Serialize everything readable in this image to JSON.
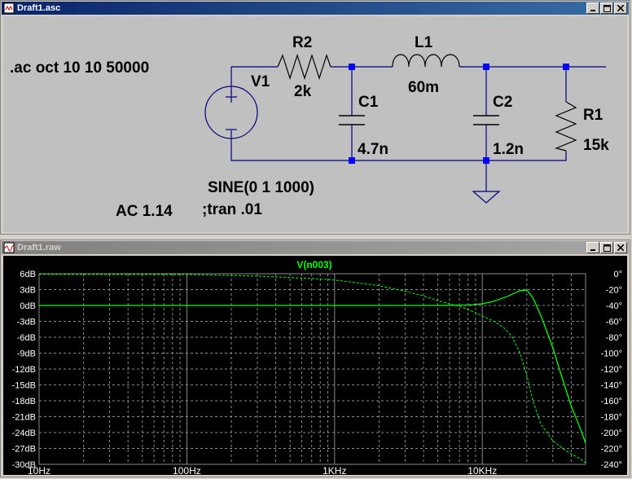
{
  "schematic_window": {
    "title": "Draft1.asc",
    "directives": {
      "ac": ".ac oct 10 10 50000",
      "source_sine": "SINE(0 1 1000)",
      "source_ac": "AC 1.14",
      "tran": ";tran .01"
    },
    "components": {
      "v1_name": "V1",
      "r2_name": "R2",
      "r2_value": "2k",
      "l1_name": "L1",
      "l1_value": "60m",
      "c1_name": "C1",
      "c1_value": "4.7n",
      "c2_name": "C2",
      "c2_value": "1.2n",
      "r1_name": "R1",
      "r1_value": "15k"
    }
  },
  "waveform_window": {
    "title": "Draft1.raw",
    "trace_label": "V(n003)",
    "trace_color": "#00ff00",
    "grid_color": "#8a8a8a"
  },
  "chart_data": {
    "type": "line",
    "x_scale": "log",
    "xlim": [
      10,
      50000
    ],
    "x_ticks": [
      "10Hz",
      "100Hz",
      "1KHz",
      "10KHz"
    ],
    "y_left_ticks": [
      "6dB",
      "3dB",
      "0dB",
      "-3dB",
      "-6dB",
      "-9dB",
      "-12dB",
      "-15dB",
      "-18dB",
      "-21dB",
      "-24dB",
      "-27dB",
      "-30dB"
    ],
    "y_right_ticks": [
      "0°",
      "-20°",
      "-40°",
      "-60°",
      "-80°",
      "-100°",
      "-120°",
      "-140°",
      "-160°",
      "-180°",
      "-200°",
      "-220°",
      "-240°"
    ],
    "ylim_db": [
      -30,
      6
    ],
    "ylim_phase": [
      -240,
      0
    ],
    "series": [
      {
        "name": "V(n003)",
        "axis": "magnitude",
        "x": [
          10,
          100,
          1000,
          5000,
          8000,
          10000,
          12000,
          15000,
          18000,
          20000,
          22000,
          25000,
          30000,
          35000,
          40000,
          45000,
          50000
        ],
        "y": [
          0,
          0,
          0,
          0,
          0.1,
          0.3,
          0.8,
          1.8,
          2.8,
          2.9,
          1.5,
          -2,
          -8,
          -14,
          -19,
          -22.5,
          -26
        ]
      },
      {
        "name": "V(n003)",
        "axis": "phase",
        "x": [
          10,
          100,
          300,
          700,
          1000,
          1500,
          2000,
          3000,
          4000,
          5000,
          6000,
          7000,
          8000,
          9000,
          10000,
          12000,
          14000,
          16000,
          18000,
          20000,
          22000,
          25000,
          30000,
          35000,
          40000,
          45000,
          50000
        ],
        "y": [
          -0.7,
          -1,
          -3,
          -6,
          -8,
          -12,
          -15,
          -22,
          -28,
          -34,
          -38,
          -41,
          -45,
          -49,
          -53,
          -60,
          -68,
          -80,
          -100,
          -128,
          -160,
          -190,
          -210,
          -220,
          -227,
          -232,
          -238
        ]
      }
    ]
  }
}
